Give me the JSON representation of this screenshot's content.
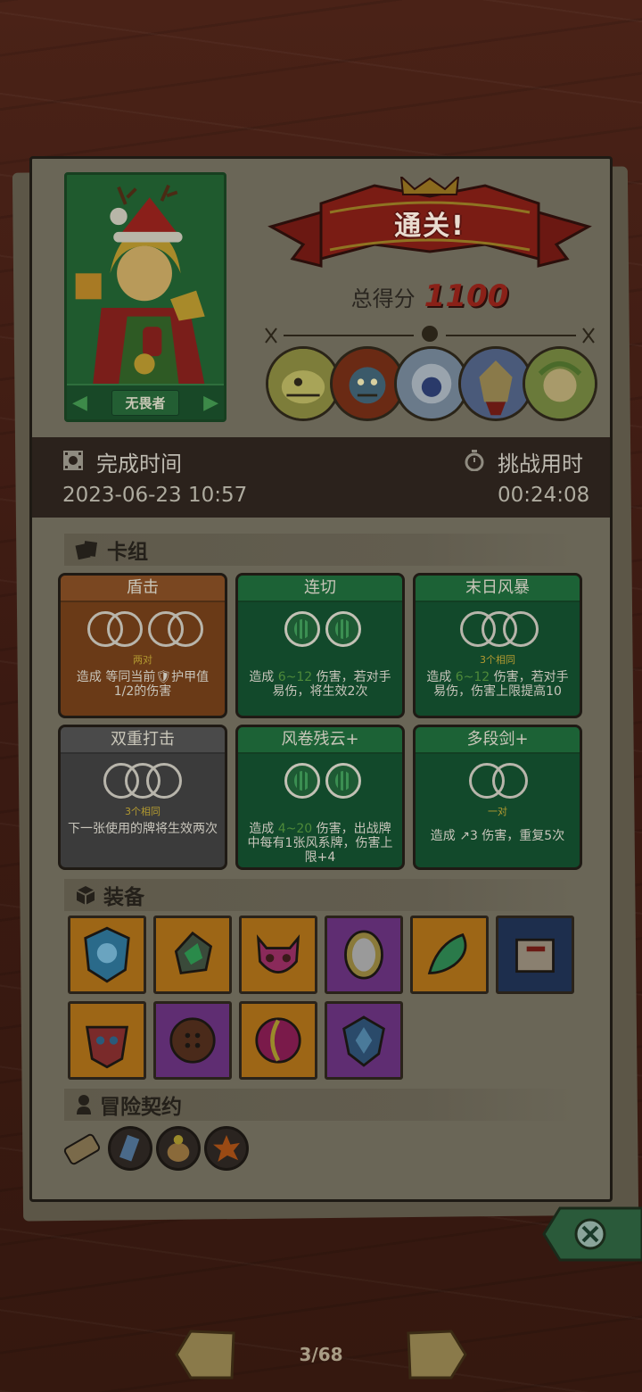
{
  "hero": {
    "name": "无畏者"
  },
  "result": {
    "banner": "通关!",
    "score_label": "总得分",
    "score_value": "1100"
  },
  "time": {
    "finish_label": "完成时间",
    "finish_value": "2023-06-23 10:57",
    "duration_label": "挑战用时",
    "duration_value": "00:24:08"
  },
  "sections": {
    "deck": "卡组",
    "equipment": "装备",
    "contract": "冒险契约"
  },
  "cards": [
    {
      "title": "盾击",
      "sub": "两对",
      "desc": "造成 等同当前🛡护甲值1/2的伤害"
    },
    {
      "title": "连切",
      "sub": "",
      "desc_pre": "造成 ",
      "desc_hl": "6~12",
      "desc_post": " 伤害，若对手 易伤，将生效2次"
    },
    {
      "title": "末日风暴",
      "sub": "3个相同",
      "desc_pre": "造成 ",
      "desc_hl": "6~12",
      "desc_post": " 伤害，若对手 易伤，伤害上限提高10"
    },
    {
      "title": "双重打击",
      "sub": "3个相同",
      "desc": "下一张使用的牌将生效两次"
    },
    {
      "title": "风卷残云+",
      "sub": "",
      "desc_pre": "造成 ",
      "desc_hl": "4~20",
      "desc_post": " 伤害，出战牌中每有1张风系牌，伤害上限+4"
    },
    {
      "title": "多段剑+",
      "sub": "一对",
      "desc": "造成 ↗3 伤害，重复5次"
    }
  ],
  "equipment": [
    {
      "icon": "ice-shield-icon",
      "color": "#9d6616"
    },
    {
      "icon": "green-gem-icon",
      "color": "#9d6616"
    },
    {
      "icon": "demon-mask-icon",
      "color": "#9d6616"
    },
    {
      "icon": "magic-mirror-icon",
      "color": "#5f2d72"
    },
    {
      "icon": "leaf-sprite-icon",
      "color": "#9d6616"
    },
    {
      "icon": "scroll-icon",
      "color": "#1d2e4d"
    },
    {
      "icon": "tribal-mask-icon",
      "color": "#9d6616"
    },
    {
      "icon": "button-disc-icon",
      "color": "#5f2d72"
    },
    {
      "icon": "swirl-orb-icon",
      "color": "#9d6616"
    },
    {
      "icon": "crystal-shield-icon",
      "color": "#5f2d72"
    }
  ],
  "contracts": [
    "contract-scroll-icon",
    "ice-rune-icon",
    "potion-sack-icon",
    "fire-burst-icon"
  ],
  "pagination": {
    "current": "3/68"
  }
}
